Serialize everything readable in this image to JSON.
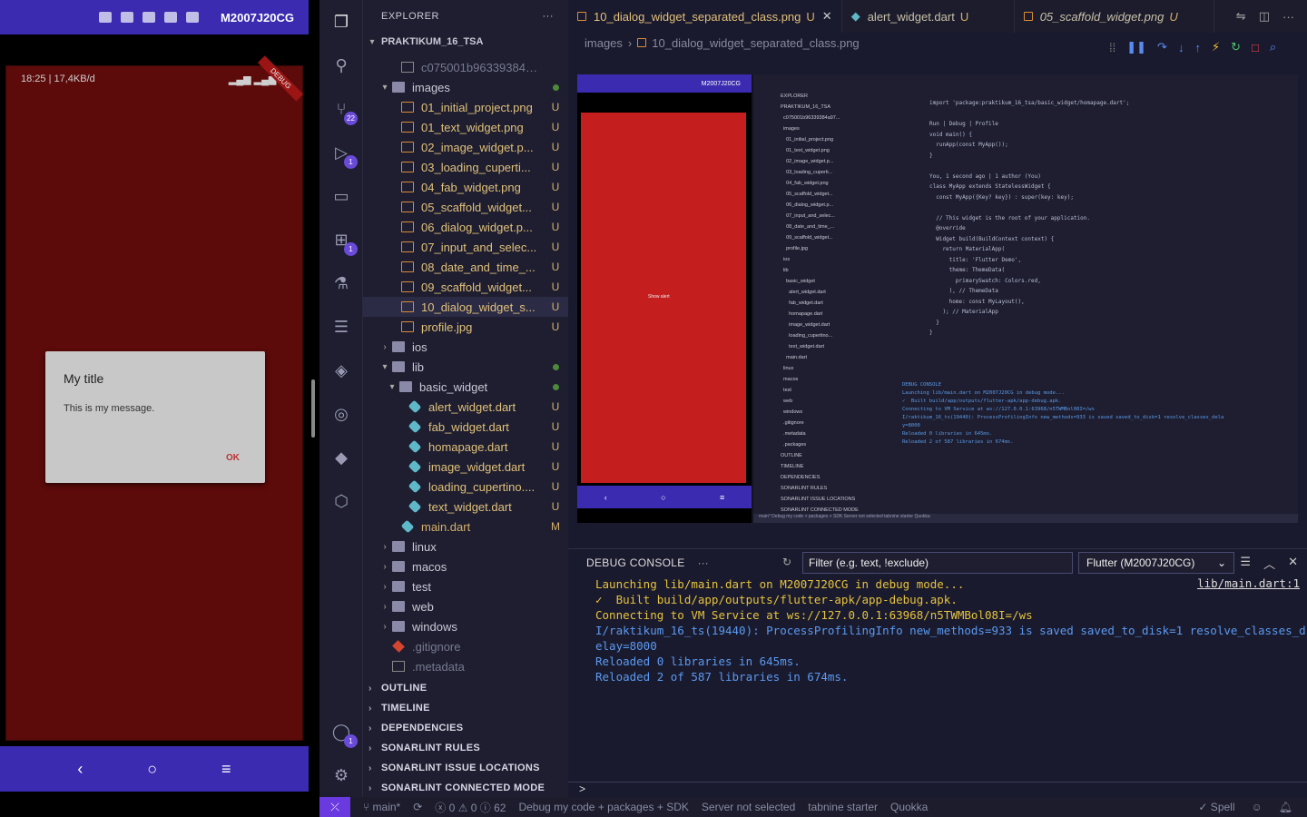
{
  "phone": {
    "device_name": "M2007J20CG",
    "status_left": "18:25 | 17,4KB/d",
    "debug_ribbon": "DEBUG",
    "dialog": {
      "title": "My title",
      "message": "This is my message.",
      "ok": "OK"
    },
    "nav": {
      "back": "‹",
      "home": "○",
      "menu": "≡"
    }
  },
  "activity": {
    "scm_badge": "22",
    "run_badge": "1",
    "ext_badge": "1",
    "account_badge": "1"
  },
  "explorer": {
    "header": "EXPLORER",
    "root": "PRAKTIKUM_16_TSA",
    "items": [
      {
        "name": "c075001b96339384a97...",
        "status": "",
        "type": "file",
        "indent": 40,
        "dim": true
      },
      {
        "name": "images",
        "status": "",
        "type": "folder",
        "indent": 18,
        "open": true,
        "dot": true
      },
      {
        "name": "01_initial_project.png",
        "status": "U",
        "type": "img",
        "indent": 40
      },
      {
        "name": "01_text_widget.png",
        "status": "U",
        "type": "img",
        "indent": 40
      },
      {
        "name": "02_image_widget.p...",
        "status": "U",
        "type": "img",
        "indent": 40
      },
      {
        "name": "03_loading_cuperti...",
        "status": "U",
        "type": "img",
        "indent": 40
      },
      {
        "name": "04_fab_widget.png",
        "status": "U",
        "type": "img",
        "indent": 40
      },
      {
        "name": "05_scaffold_widget...",
        "status": "U",
        "type": "img",
        "indent": 40
      },
      {
        "name": "06_dialog_widget.p...",
        "status": "U",
        "type": "img",
        "indent": 40
      },
      {
        "name": "07_input_and_selec...",
        "status": "U",
        "type": "img",
        "indent": 40
      },
      {
        "name": "08_date_and_time_...",
        "status": "U",
        "type": "img",
        "indent": 40
      },
      {
        "name": "09_scaffold_widget...",
        "status": "U",
        "type": "img",
        "indent": 40
      },
      {
        "name": "10_dialog_widget_s...",
        "status": "U",
        "type": "img",
        "indent": 40,
        "selected": true
      },
      {
        "name": "profile.jpg",
        "status": "U",
        "type": "img",
        "indent": 40
      },
      {
        "name": "ios",
        "status": "",
        "type": "folder",
        "indent": 18,
        "open": false
      },
      {
        "name": "lib",
        "status": "",
        "type": "folder",
        "indent": 18,
        "open": true,
        "dot": true
      },
      {
        "name": "basic_widget",
        "status": "",
        "type": "folder",
        "indent": 26,
        "open": true,
        "dot": true
      },
      {
        "name": "alert_widget.dart",
        "status": "U",
        "type": "dart",
        "indent": 48
      },
      {
        "name": "fab_widget.dart",
        "status": "U",
        "type": "dart",
        "indent": 48
      },
      {
        "name": "homapage.dart",
        "status": "U",
        "type": "dart",
        "indent": 48
      },
      {
        "name": "image_widget.dart",
        "status": "U",
        "type": "dart",
        "indent": 48
      },
      {
        "name": "loading_cupertino....",
        "status": "U",
        "type": "dart",
        "indent": 48
      },
      {
        "name": "text_widget.dart",
        "status": "U",
        "type": "dart",
        "indent": 48
      },
      {
        "name": "main.dart",
        "status": "M",
        "type": "dart",
        "indent": 40
      },
      {
        "name": "linux",
        "status": "",
        "type": "folder",
        "indent": 18,
        "open": false
      },
      {
        "name": "macos",
        "status": "",
        "type": "folder",
        "indent": 18,
        "open": false
      },
      {
        "name": "test",
        "status": "",
        "type": "folder",
        "indent": 18,
        "open": false
      },
      {
        "name": "web",
        "status": "",
        "type": "folder",
        "indent": 18,
        "open": false
      },
      {
        "name": "windows",
        "status": "",
        "type": "folder",
        "indent": 18,
        "open": false
      },
      {
        "name": ".gitignore",
        "status": "",
        "type": "git",
        "indent": 30,
        "dim": true
      },
      {
        "name": ".metadata",
        "status": "",
        "type": "file",
        "indent": 30,
        "dim": true
      }
    ],
    "sections": [
      "OUTLINE",
      "TIMELINE",
      "DEPENDENCIES",
      "SONARLINT RULES",
      "SONARLINT ISSUE LOCATIONS",
      "SONARLINT CONNECTED MODE"
    ]
  },
  "tabs": [
    {
      "label": "10_dialog_widget_separated_class.png",
      "status": "U",
      "active": true
    },
    {
      "label": "alert_widget.dart",
      "status": "U",
      "active": false
    },
    {
      "label": "05_scaffold_widget.png",
      "status": "U",
      "active": false
    }
  ],
  "breadcrumb": {
    "folder": "images",
    "file": "10_dialog_widget_separated_class.png"
  },
  "console": {
    "title": "DEBUG CONSOLE",
    "filter_placeholder": "Filter (e.g. text, !exclude)",
    "device": "Flutter (M2007J20CG)",
    "link": "lib/main.dart:1",
    "lines": [
      {
        "text": "Launching lib/main.dart on M2007J20CG in debug mode...",
        "color": "y"
      },
      {
        "text": "✓  Built build/app/outputs/flutter-apk/app-debug.apk.",
        "color": "y"
      },
      {
        "text": "Connecting to VM Service at ws://127.0.0.1:63968/n5TWMBol08I=/ws",
        "color": "y"
      },
      {
        "text": "I/raktikum_16_ts(19440): ProcessProfilingInfo new_methods=933 is saved saved_to_disk=1 resolve_classes_delay=8000",
        "color": "b"
      },
      {
        "text": "Reloaded 0 libraries in 645ms.",
        "color": "b"
      },
      {
        "text": "Reloaded 2 of 587 libraries in 674ms.",
        "color": "b"
      }
    ],
    "prompt": ">"
  },
  "statusbar": {
    "branch": "main*",
    "problems": "0 ⚠ 0 ⓘ 62",
    "debug_target": "Debug my code + packages + SDK",
    "server": "Server not selected",
    "tabnine": "tabnine starter",
    "quokka": "Quokka",
    "spell": "✓ Spell"
  },
  "preview": {
    "phone_name": "M2007J20CG",
    "show_alert": "Show alert",
    "code": "import 'package:praktikum_16_tsa/basic_widget/homapage.dart';\n\nRun | Debug | Profile\nvoid main() {\n  runApp(const MyApp());\n}\n\nYou, 1 second ago | 1 author (You)\nclass MyApp extends StatelessWidget {\n  const MyApp({Key? key}) : super(key: key);\n\n  // This widget is the root of your application.\n  @override\n  Widget build(BuildContext context) {\n    return MaterialApp(\n      title: 'Flutter Demo',\n      theme: ThemeData(\n        primarySwatch: Colors.red,\n      ), // ThemeData\n      home: const MyLayout(),\n    ); // MaterialApp\n  }\n}",
    "explorer": "EXPLORER\nPRAKTIKUM_16_TSA\n  c075001b96339384a97...\n  images\n    01_initial_project.png\n    01_text_widget.png\n    02_image_widget.p...\n    03_loading_cuperti...\n    04_fab_widget.png\n    05_scaffold_widget...\n    06_dialog_widget.p...\n    07_input_and_selec...\n    08_date_and_time_...\n    09_scaffold_widget...\n    profile.jpg\n  ios\n  lib\n    basic_widget\n      alert_widget.dart\n      fab_widget.dart\n      homapage.dart\n      image_widget.dart\n      loading_cupertino...\n      text_widget.dart\n    main.dart\n  linux\n  macos\n  test\n  web\n  windows\n  .gitignore\n  .metadata\n  .packages\nOUTLINE\nTIMELINE\nDEPENDENCIES\nSONARLINT RULES\nSONARLINT ISSUE LOCATIONS\nSONARLINT CONNECTED MODE",
    "console": "DEBUG CONSOLE\nLaunching lib/main.dart on M2007J20CG in debug mode...\n✓  Built build/app/outputs/flutter-apk/app-debug.apk.\nConnecting to VM Service at ws://127.0.0.1:63968/n5TWMBol08I=/ws\nI/raktikum_16_ts(19440): ProcessProfilingInfo new_methods=933 is saved saved_to_disk=1 resolve_classes_dela\ny=8000\nReloaded 0 libraries in 645ms.\nReloaded 2 of 587 libraries in 674ms.",
    "status": "main*   Debug my code + packages + SDK   Server not selected   tabnine starter   Quokka"
  }
}
